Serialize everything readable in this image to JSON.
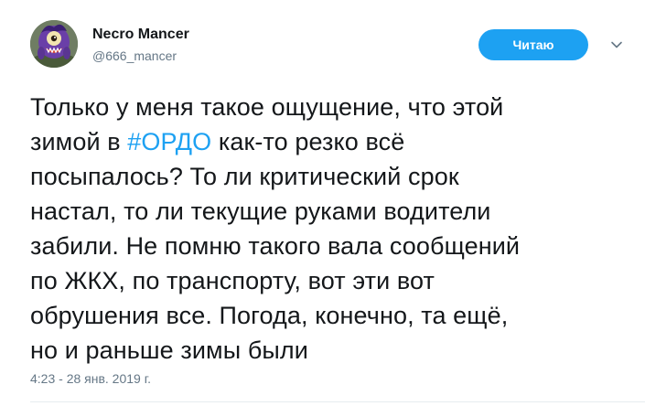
{
  "user": {
    "display_name": "Necro Mancer",
    "handle": "@666_mancer",
    "avatar_icon": "purple-monster-avatar"
  },
  "follow_button": {
    "label": "Читаю",
    "color": "#1da1f2"
  },
  "menu_icon": "chevron-down-icon",
  "tweet": {
    "line1": "Только у меня такое ощущение, что этой",
    "line2_pre": "зимой в ",
    "hashtag": "#ОРДО",
    "line2_post": " как-то резко всё",
    "line3": "посыпалось? То ли критический срок",
    "line4": "настал, то ли текущие руками водители",
    "line5": "забили. Не помню такого вала сообщений",
    "line6": "по ЖКХ, по транспорту, вот эти вот",
    "line7": "обрушения все. Погода, конечно, та ещё,",
    "line8": "но и раньше зимы были"
  },
  "timestamp": "4:23 - 28 янв. 2019 г."
}
